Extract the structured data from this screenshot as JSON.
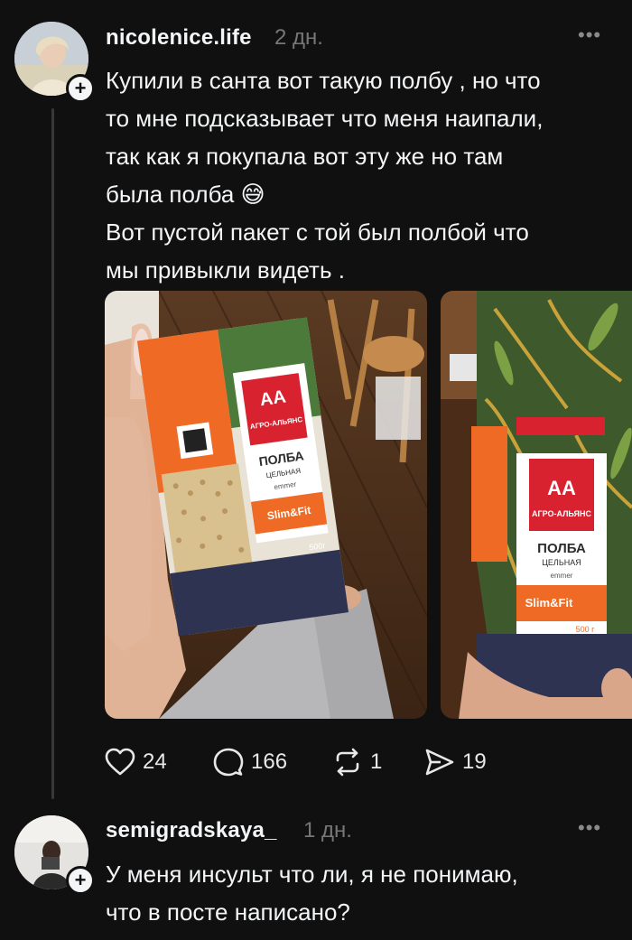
{
  "post": {
    "username": "nicolenice.life",
    "time": "2 дн.",
    "more_icon": "ellipsis-icon",
    "text_lines": [
      "Купили в санта вот такую полбу , но что",
      "то мне подсказывает что меня наипали,",
      "так как я покупала вот эту же но там",
      "была полба 😅",
      "Вот пустой пакет с той был полбой что",
      "мы привыкли видеть ."
    ],
    "photos": [
      {
        "brand": "АГРО-АЛЬЯНС",
        "product": "ПОЛБА",
        "subtitle": "ЦЕЛЬНАЯ",
        "latin": "emmer",
        "series": "Slim&Fit",
        "weight": "500г"
      },
      {
        "brand": "АГРО-АЛЬЯНС",
        "product": "ПОЛБА",
        "subtitle": "ЦЕЛЬНАЯ",
        "latin": "emmer",
        "series": "Slim&Fit",
        "weight": "500 г"
      }
    ],
    "actions": {
      "likes": "24",
      "comments": "166",
      "reposts": "1",
      "shares": "19"
    }
  },
  "reply": {
    "username": "semigradskaya_",
    "time": "1 дн.",
    "more_icon": "ellipsis-icon",
    "text_lines": [
      "У меня инсульт что ли, я не понимаю,",
      "что в посте написано?"
    ]
  },
  "colors": {
    "background": "#101010",
    "text": "#f3f5f7",
    "muted": "#777777",
    "thread_line": "#383838"
  }
}
